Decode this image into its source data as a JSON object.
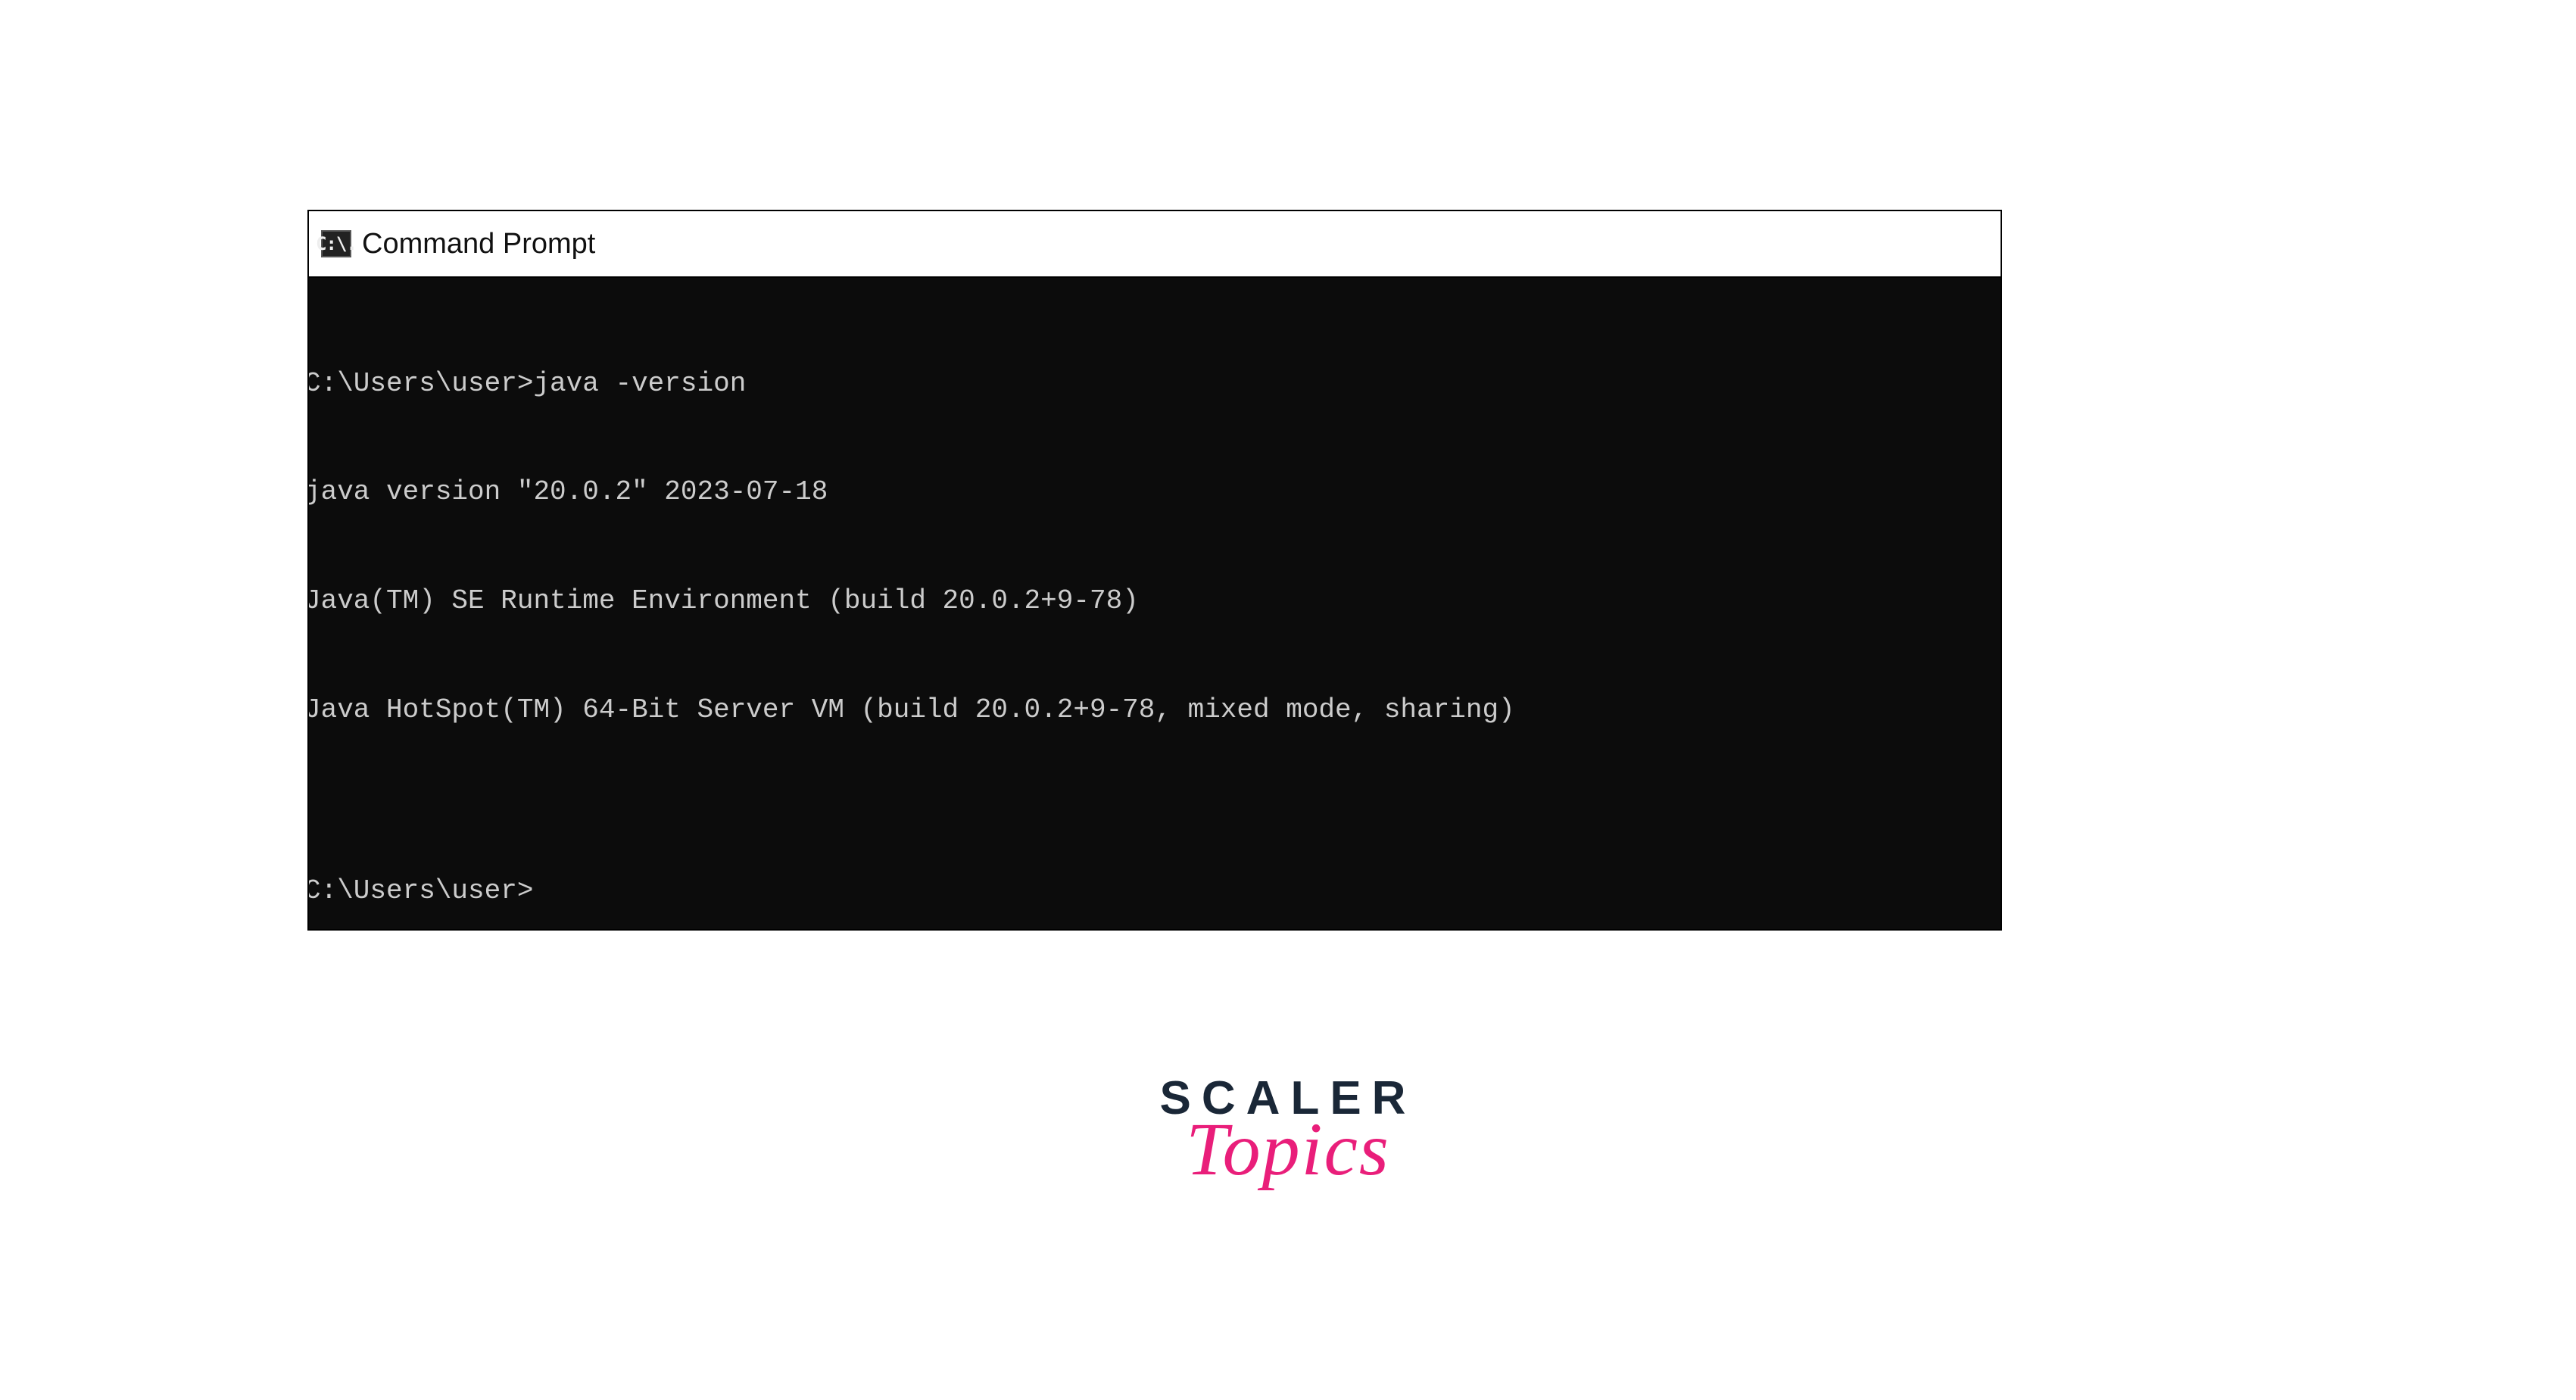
{
  "window": {
    "title": "Command Prompt",
    "icon_glyph": "C:\\.",
    "icon_name": "cmd-icon"
  },
  "terminal": {
    "lines": [
      "C:\\Users\\user>java -version",
      "java version \"20.0.2\" 2023-07-18",
      "Java(TM) SE Runtime Environment (build 20.0.2+9-78)",
      "Java HotSpot(TM) 64-Bit Server VM (build 20.0.2+9-78, mixed mode, sharing)",
      "",
      "C:\\Users\\user>"
    ]
  },
  "branding": {
    "line1": "SCALER",
    "line2": "Topics"
  }
}
